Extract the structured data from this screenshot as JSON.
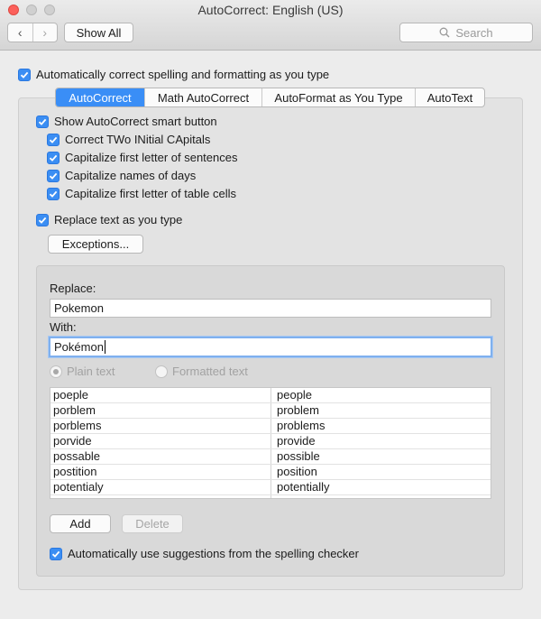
{
  "window": {
    "title": "AutoCorrect: English (US)",
    "back_symbol": "‹",
    "forward_symbol": "›",
    "show_all_label": "Show All",
    "search_placeholder": "Search"
  },
  "main_option": {
    "label": "Automatically correct spelling and formatting as you type",
    "checked": true
  },
  "tabs": [
    {
      "label": "AutoCorrect",
      "active": true
    },
    {
      "label": "Math AutoCorrect",
      "active": false
    },
    {
      "label": "AutoFormat as You Type",
      "active": false
    },
    {
      "label": "AutoText",
      "active": false
    }
  ],
  "options": {
    "show_button": "Show AutoCorrect smart button",
    "two_initial": "Correct TWo INitial CApitals",
    "first_letter": "Capitalize first letter of sentences",
    "names_of_days": "Capitalize names of days",
    "table_cells": "Capitalize first letter of table cells",
    "replace_text": "Replace text as you type"
  },
  "exceptions_label": "Exceptions...",
  "replace": {
    "replace_label": "Replace:",
    "replace_value": "Pokemon",
    "with_label": "With:",
    "with_value": "Pokémon",
    "plain_text_label": "Plain text",
    "formatted_text_label": "Formatted text"
  },
  "entries": [
    {
      "replace": "poeple",
      "with": "people"
    },
    {
      "replace": "porblem",
      "with": "problem"
    },
    {
      "replace": "porblems",
      "with": "problems"
    },
    {
      "replace": "porvide",
      "with": "provide"
    },
    {
      "replace": "possable",
      "with": "possible"
    },
    {
      "replace": "postition",
      "with": "position"
    },
    {
      "replace": "potentialy",
      "with": "potentially"
    }
  ],
  "add_label": "Add",
  "delete_label": "Delete",
  "suggestions_label": "Automatically use suggestions from the spelling checker",
  "colors": {
    "accent": "#3b8ef3",
    "close_button": "#fc605b"
  }
}
